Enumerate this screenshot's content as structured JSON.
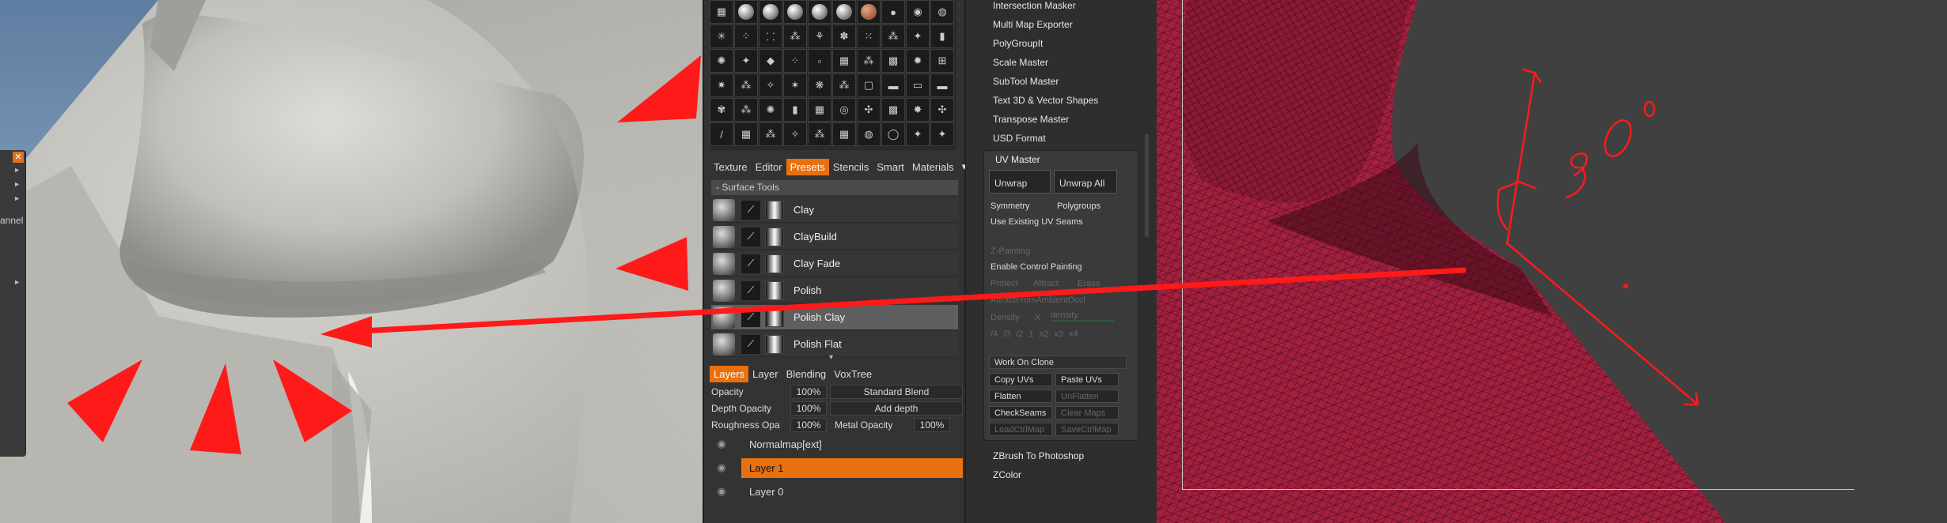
{
  "left_viewport": {
    "menu_close": "✕",
    "menu_label": "annel"
  },
  "palette": {
    "thumb_icons": [
      "▦",
      "◐",
      "●",
      "◍",
      "◯",
      "⬤",
      "▭",
      "●",
      "◉",
      "◍",
      "✳",
      "⁘",
      "⸬",
      "⁂",
      "⚘",
      "✽",
      "⁙",
      "⁂",
      "✦",
      "▮",
      "✺",
      "✦",
      "◆",
      "⁘",
      "▫",
      "▦",
      "⁂",
      "▩",
      "✹",
      "⊞",
      "✷",
      "⁂",
      "✧",
      "✶",
      "❋",
      "⁂",
      "▢",
      "▬",
      "▭",
      "▬",
      "✾",
      "⁂",
      "✺",
      "▮",
      "▦",
      "◎",
      "✣",
      "▩",
      "✸",
      "✣",
      "/",
      "▦",
      "⁂",
      "✧",
      "⁂",
      "▦",
      "◍",
      "◯",
      "✦",
      "✦"
    ],
    "tabs": [
      {
        "label": "Texture"
      },
      {
        "label": "Editor"
      },
      {
        "label": "Presets",
        "active": true
      },
      {
        "label": "Stencils"
      },
      {
        "label": "Smart"
      },
      {
        "label": "Materials"
      }
    ],
    "tab_menu": "▾",
    "section_title": "- Surface  Tools",
    "tools": [
      "Clay",
      "ClayBuild",
      "Clay  Fade",
      "Polish",
      "Polish  Clay",
      "Polish  Flat"
    ],
    "selected_tool": "Polish  Clay",
    "scroll_indicator": "▾",
    "layer_tabs": [
      {
        "label": "Layers",
        "active": true
      },
      {
        "label": "Layer"
      },
      {
        "label": "Blending"
      },
      {
        "label": "VoxTree"
      }
    ],
    "props": {
      "opacity_label": "Opacity",
      "opacity_value": "100%",
      "opacity_blend": "Standard  Blend",
      "depth_label": "Depth  Opacity",
      "depth_value": "100%",
      "depth_blend": "Add  depth",
      "rough_label": "Roughness  Opa",
      "rough_value": "100%",
      "metal_label": "Metal  Opacity",
      "metal_value": "100%"
    },
    "layers": [
      {
        "name": "Normalmap[ext]"
      },
      {
        "name": "Layer  1",
        "active": true
      },
      {
        "name": "Layer  0"
      }
    ],
    "eye_icon": "👁"
  },
  "plugins": {
    "top_items": [
      "Intersection Masker",
      "Multi Map Exporter",
      "PolyGroupIt",
      "Scale Master",
      "SubTool Master",
      "Text 3D & Vector Shapes",
      "Transpose Master",
      "USD Format"
    ],
    "uv_master": {
      "title": "UV Master",
      "unwrap": "Unwrap",
      "unwrap_all": "Unwrap All",
      "symmetry": "Symmetry",
      "polygroups": "Polygroups",
      "use_existing": "Use Existing UV Seams",
      "z_painting": "Z-Painting",
      "enable_control": "Enable Control Painting",
      "protect": "Protect",
      "attract": "Attract",
      "erase": "Erase",
      "attract_ao": "AttractFromAmbientOccl",
      "density": "Density",
      "x": "X",
      "density_slider": "density",
      "density_buttons": [
        "/4",
        "/3",
        "/2",
        "1",
        "x2",
        "x3",
        "x4"
      ],
      "work_on_clone": "Work On Clone",
      "copy_uvs": "Copy UVs",
      "paste_uvs": "Paste UVs",
      "flatten": "Flatten",
      "unflatten": "UnFlatten",
      "checkseams": "CheckSeams",
      "clear_maps": "Clear Maps",
      "load_ctrl": "LoadCtrlMap",
      "save_ctrl": "SaveCtrlMap"
    },
    "bottom_items": [
      "ZBrush To Photoshop",
      "ZColor"
    ]
  },
  "right_viewport": {
    "annotation": "90°"
  },
  "colors": {
    "accent": "#e8700e",
    "annotation_red": "#ff1a1a",
    "mesh": "#a3203f"
  }
}
